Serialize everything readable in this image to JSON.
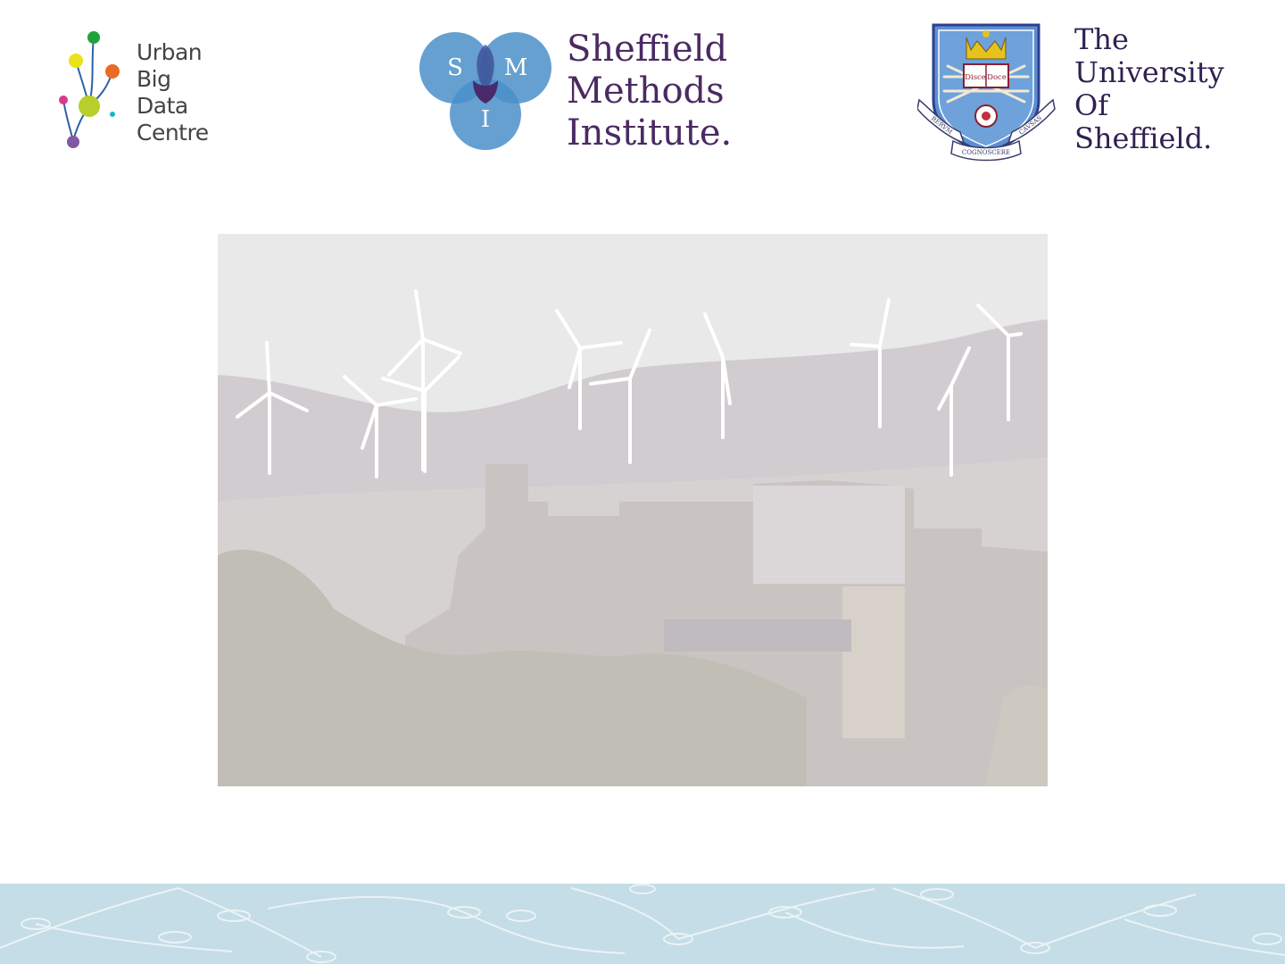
{
  "header": {
    "ubdc_logo": {
      "lines": [
        "Urban",
        "Big",
        "Data",
        "Centre"
      ],
      "dot_colors": [
        "#1fa23b",
        "#e8e31a",
        "#ea6b22",
        "#d83a8c",
        "#b6cf2a",
        "#1cb3c8",
        "#8058a6"
      ]
    },
    "smi_logo": {
      "letters": [
        "S",
        "M",
        "I"
      ],
      "lines": [
        "Sheffield",
        "Methods",
        "Institute."
      ],
      "circle_color": "#4a8fc9",
      "text_color": "#4b2a63"
    },
    "uos_logo": {
      "crest_text": [
        "RERVM",
        "COGNOSCERE",
        "CAVSAS"
      ],
      "book_text": [
        "Disce",
        "Doce"
      ],
      "lines": [
        "The",
        "University",
        "Of",
        "Sheffield."
      ],
      "text_color": "#2f2150"
    }
  },
  "main": {
    "photo": {
      "icon": "castle-windfarm-photo"
    }
  },
  "footer": {
    "background": "#c5dde6",
    "pattern": "network-nodes-pattern"
  }
}
